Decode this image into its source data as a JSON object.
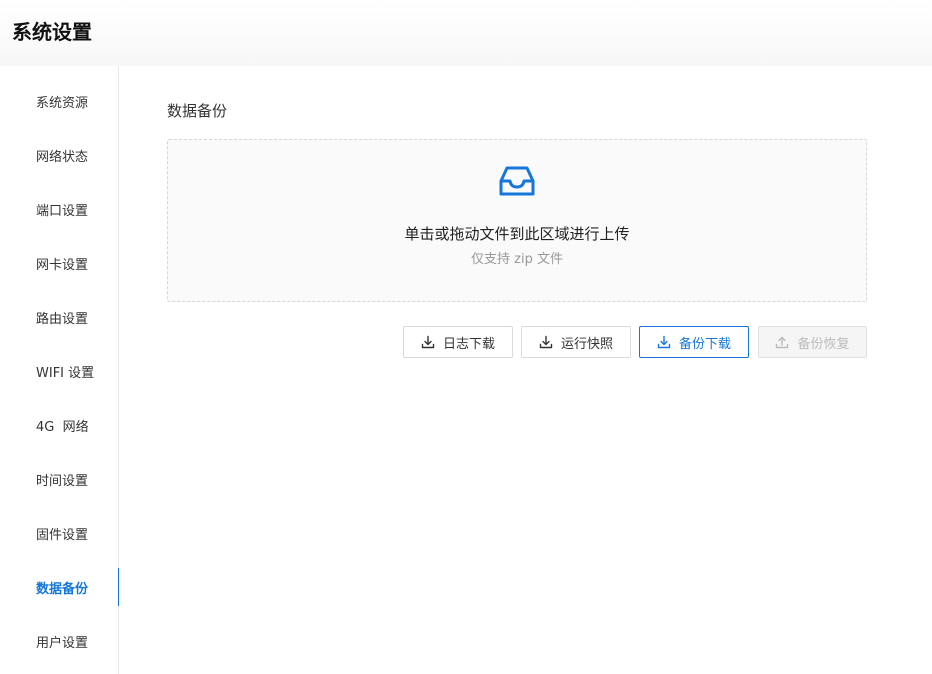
{
  "header": {
    "title": "系统设置"
  },
  "sidebar": {
    "items": [
      {
        "label": "系统资源"
      },
      {
        "label": "网络状态"
      },
      {
        "label": "端口设置"
      },
      {
        "label": "网卡设置"
      },
      {
        "label": "路由设置"
      },
      {
        "label": "WIFI 设置"
      },
      {
        "label": "4G  网络"
      },
      {
        "label": "时间设置"
      },
      {
        "label": "固件设置"
      },
      {
        "label": "数据备份",
        "active": true
      },
      {
        "label": "用户设置"
      }
    ]
  },
  "main": {
    "section_title": "数据备份",
    "upload": {
      "icon": "inbox-icon",
      "text": "单击或拖动文件到此区域进行上传",
      "hint": "仅支持 zip 文件"
    },
    "buttons": {
      "log_download": {
        "label": "日志下载",
        "icon": "download-icon"
      },
      "run_snapshot": {
        "label": "运行快照",
        "icon": "download-icon"
      },
      "backup_download": {
        "label": "备份下载",
        "icon": "download-icon"
      },
      "backup_restore": {
        "label": "备份恢复",
        "icon": "upload-icon",
        "disabled": true
      }
    }
  },
  "colors": {
    "accent": "#1677d9",
    "disabled_text": "#bbbbbb",
    "border": "#d9d9d9"
  }
}
